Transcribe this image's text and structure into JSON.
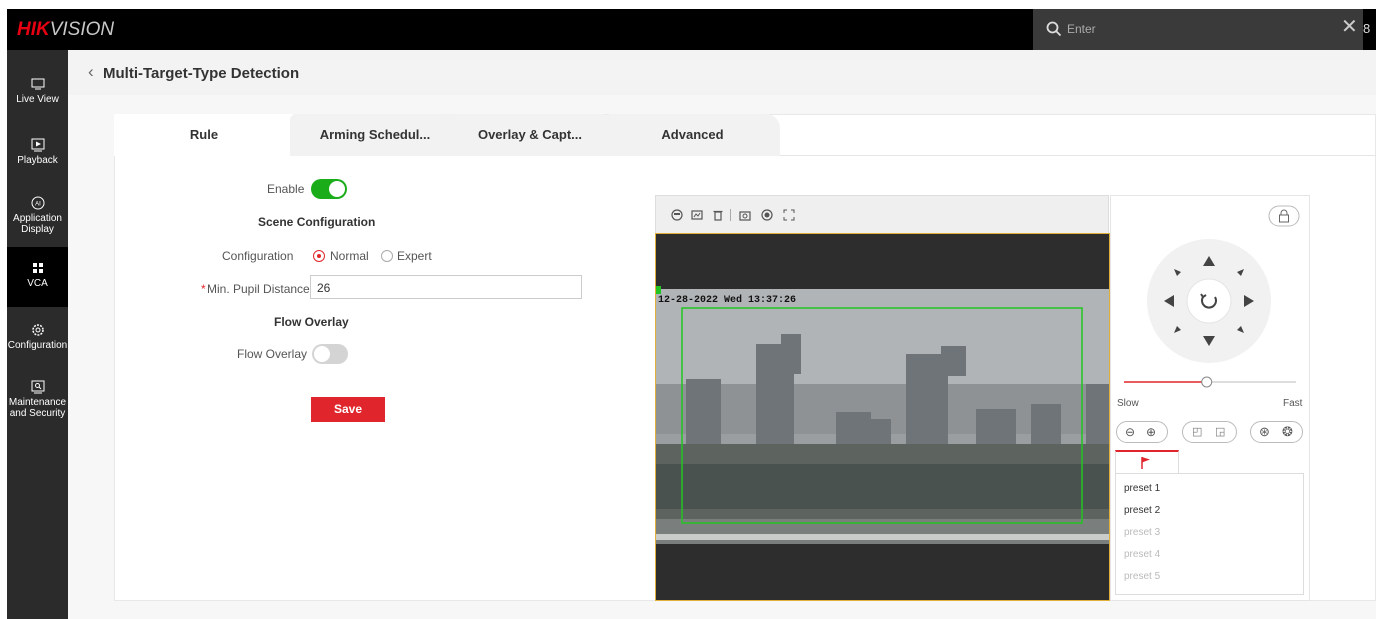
{
  "brand": {
    "hik": "HIK",
    "vision": "VISION"
  },
  "search": {
    "placeholder": "Enter"
  },
  "sidebar": {
    "items": [
      {
        "label": "Live View"
      },
      {
        "label": "Playback"
      },
      {
        "label_line1": "Application",
        "label_line2": "Display"
      },
      {
        "label": "VCA"
      },
      {
        "label": "Configuration"
      },
      {
        "label_line1": "Maintenance",
        "label_line2": "and Security"
      }
    ]
  },
  "header": {
    "title": "Multi-Target-Type Detection"
  },
  "tabs": [
    "Rule",
    "Arming Schedul...",
    "Overlay & Capt...",
    "Advanced"
  ],
  "form": {
    "enable_label": "Enable",
    "enable_on": true,
    "scene_title": "Scene Configuration",
    "config_label": "Configuration",
    "config_options": [
      "Normal",
      "Expert"
    ],
    "config_selected": "Normal",
    "required_mark": "*",
    "pupil_label": "Min. Pupil Distance",
    "pupil_value": "26",
    "flow_title": "Flow Overlay",
    "flow_label": "Flow Overlay",
    "flow_on": false,
    "save_label": "Save"
  },
  "video": {
    "timestamp": "12-28-2022 Wed 13:37:26",
    "toolbar_icons": [
      "face-icon",
      "image-icon",
      "trash-icon",
      "snapshot-icon",
      "record-icon",
      "fullscreen-icon"
    ]
  },
  "ptz": {
    "speed_slow": "Slow",
    "speed_fast": "Fast",
    "speed_level": 0.48,
    "presets": [
      {
        "label": "preset 1",
        "enabled": true
      },
      {
        "label": "preset 2",
        "enabled": true
      },
      {
        "label": "preset 3",
        "enabled": false
      },
      {
        "label": "preset 4",
        "enabled": false
      },
      {
        "label": "preset 5",
        "enabled": false
      }
    ]
  },
  "colors": {
    "accent": "#e0262c",
    "toggle_on": "#1aad19",
    "detection_box": "#22c522"
  }
}
